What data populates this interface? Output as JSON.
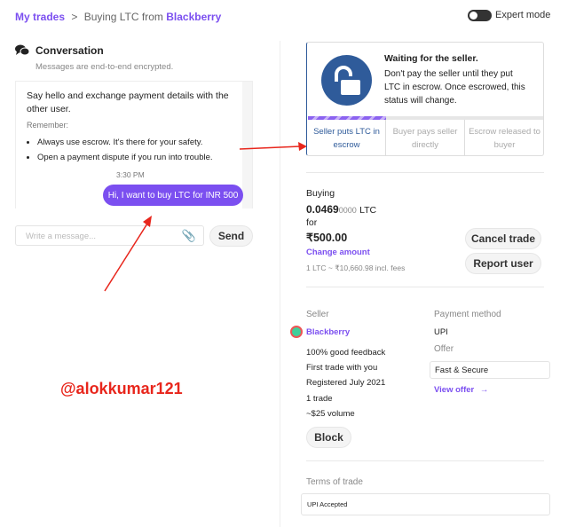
{
  "breadcrumb": {
    "root": "My trades",
    "sep": ">",
    "current_prefix": "Buying LTC from",
    "seller": "Blackberry"
  },
  "expert_mode": {
    "label": "Expert mode",
    "on": false
  },
  "conversation": {
    "title": "Conversation",
    "subtitle": "Messages are end-to-end encrypted.",
    "intro": "Say hello and exchange payment details with the other user.",
    "remember": "Remember:",
    "tips": [
      "Always use escrow. It's there for your safety.",
      "Open a payment dispute if you run into trouble."
    ],
    "time": "3:30 PM",
    "message": "Hi, I want to buy LTC for INR 500",
    "input_placeholder": "Write a message...",
    "send": "Send"
  },
  "status": {
    "title": "Waiting for the seller.",
    "body": "Don't pay the seller until they put LTC in escrow. Once escrowed, this status will change.",
    "steps": [
      "Seller puts LTC in escrow",
      "Buyer pays seller directly",
      "Escrow released to buyer"
    ],
    "active_step": 0
  },
  "trade": {
    "buying_label": "Buying",
    "amount_main": "0.0469",
    "amount_tail": "0000",
    "amount_unit": "LTC",
    "for_label": "for",
    "fiat": "₹500.00",
    "change_amount": "Change amount",
    "rate": "1 LTC ~ ₹10,660.98 incl. fees",
    "cancel": "Cancel trade",
    "report": "Report user"
  },
  "seller": {
    "label": "Seller",
    "name": "Blackberry",
    "stats": [
      "100% good feedback",
      "First trade with you",
      "Registered July 2021",
      "1 trade",
      "~$25 volume"
    ],
    "block": "Block"
  },
  "payment": {
    "label": "Payment method",
    "method": "UPI",
    "offer_label": "Offer",
    "offer": "Fast & Secure",
    "view_offer": "View offer"
  },
  "terms": {
    "label": "Terms of trade",
    "text": "UPI Accepted"
  },
  "annotation": {
    "text": "@alokkumar121",
    "color": "#e8261c"
  },
  "colors": {
    "accent": "#7b4ff0",
    "status_blue": "#2f5b9a"
  }
}
